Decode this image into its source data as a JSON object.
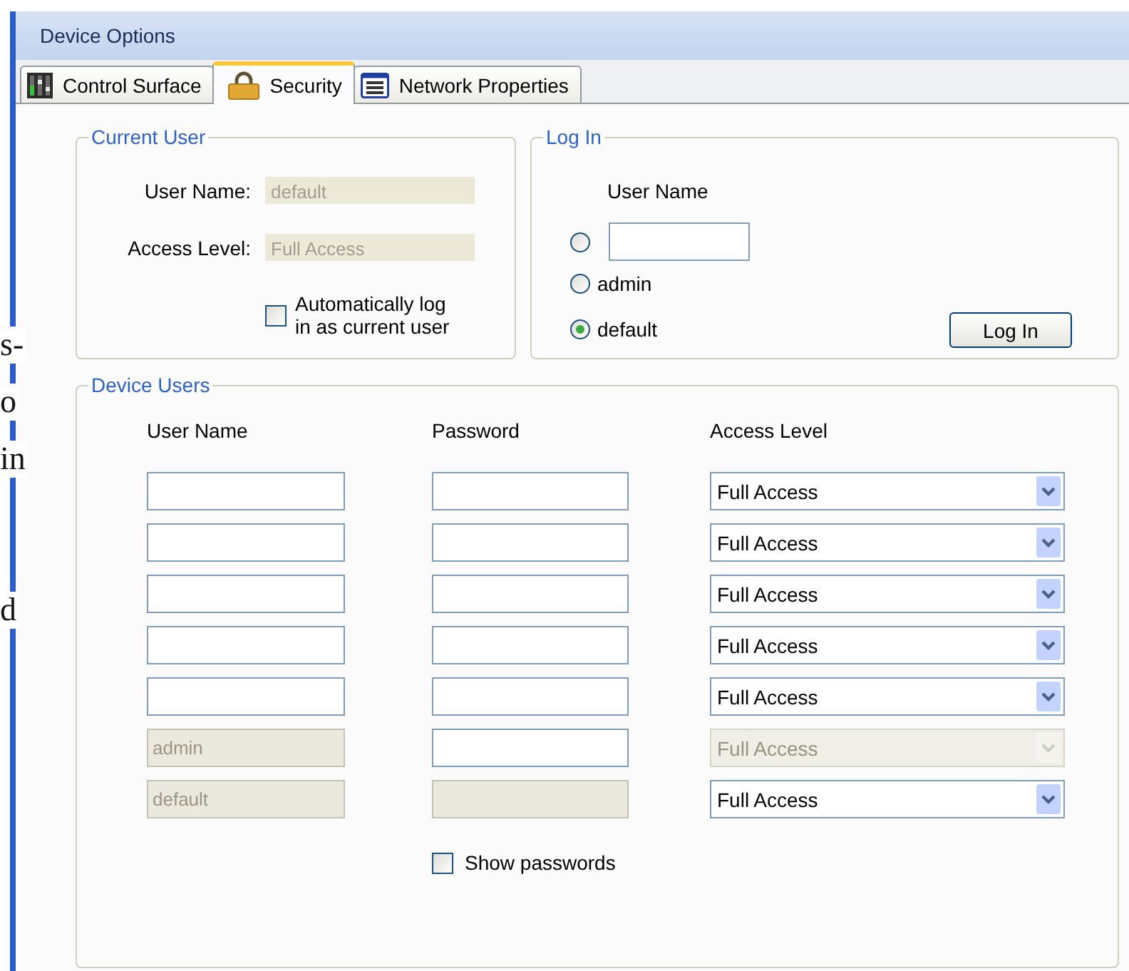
{
  "background_text": [
    "s-",
    "o",
    "in",
    "d"
  ],
  "window": {
    "title": "Device Options"
  },
  "tabs": [
    {
      "kind": "mixer",
      "label": "Control Surface",
      "selected": false
    },
    {
      "kind": "lock",
      "label": "Security",
      "selected": true
    },
    {
      "kind": "list",
      "label": "Network Properties",
      "selected": false
    }
  ],
  "current_user": {
    "title": "Current User",
    "fields": [
      {
        "label": "User Name:",
        "value": "default",
        "disabled": true
      },
      {
        "label": "Access Level:",
        "value": "Full Access",
        "disabled": true
      }
    ],
    "auto_login": {
      "label": "Automatically log in as current user",
      "checked": false
    }
  },
  "login": {
    "title": "Log In",
    "column_label": "User Name",
    "options": [
      {
        "kind": "field",
        "selected": false
      },
      {
        "kind": "name",
        "label": "admin",
        "selected": false
      },
      {
        "kind": "name",
        "label": "default",
        "selected": true
      }
    ],
    "button": "Log In"
  },
  "device_users": {
    "title": "Device Users",
    "columns": [
      "User Name",
      "Password",
      "Access Level"
    ],
    "rows": [
      {
        "user_name": {
          "disabled": false
        },
        "password": {
          "disabled": false
        },
        "access_level": {
          "value": "Full Access",
          "disabled": false
        }
      },
      {
        "user_name": {
          "disabled": false
        },
        "password": {
          "disabled": false
        },
        "access_level": {
          "value": "Full Access",
          "disabled": false
        }
      },
      {
        "user_name": {
          "disabled": false
        },
        "password": {
          "disabled": false
        },
        "access_level": {
          "value": "Full Access",
          "disabled": false
        }
      },
      {
        "user_name": {
          "disabled": false
        },
        "password": {
          "disabled": false
        },
        "access_level": {
          "value": "Full Access",
          "disabled": false
        }
      },
      {
        "user_name": {
          "disabled": false
        },
        "password": {
          "disabled": false
        },
        "access_level": {
          "value": "Full Access",
          "disabled": false
        }
      },
      {
        "user_name": {
          "value": "admin",
          "disabled": true
        },
        "password": {
          "disabled": false
        },
        "access_level": {
          "value": "Full Access",
          "disabled": true
        }
      },
      {
        "user_name": {
          "value": "default",
          "disabled": true
        },
        "password": {
          "disabled": true
        },
        "access_level": {
          "value": "Full Access",
          "disabled": false
        }
      }
    ],
    "show_passwords": {
      "label": "Show passwords",
      "checked": false
    }
  }
}
